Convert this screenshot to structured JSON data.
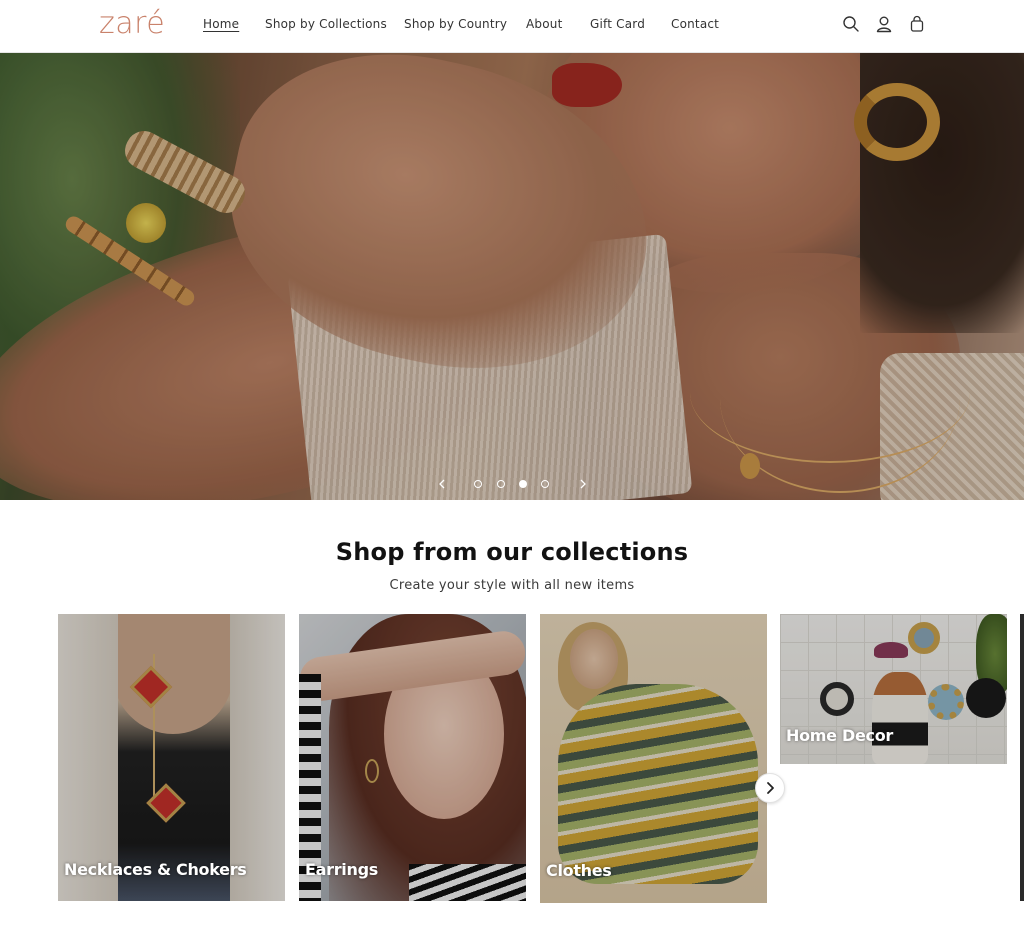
{
  "brand": {
    "logo_text": "zaré",
    "logo_color": "#c9826b"
  },
  "nav": {
    "items": [
      {
        "label": "Home",
        "active": true
      },
      {
        "label": "Shop by Collections",
        "active": false
      },
      {
        "label": "Shop by Country",
        "active": false
      },
      {
        "label": "About",
        "active": false
      },
      {
        "label": "Gift Card",
        "active": false
      },
      {
        "label": "Contact",
        "active": false
      }
    ]
  },
  "header_icons": [
    "search-icon",
    "account-icon",
    "cart-icon"
  ],
  "hero": {
    "slides_total": 4,
    "active_slide": 3,
    "prev_icon": "chevron-left-icon",
    "next_icon": "chevron-right-icon"
  },
  "collections": {
    "title": "Shop from our collections",
    "subtitle": "Create your style with all new items",
    "cards": [
      {
        "label": "Necklaces & Chokers"
      },
      {
        "label": "Earrings"
      },
      {
        "label": "Clothes"
      },
      {
        "label": "Home Decor"
      }
    ],
    "next_icon": "chevron-right-icon"
  }
}
